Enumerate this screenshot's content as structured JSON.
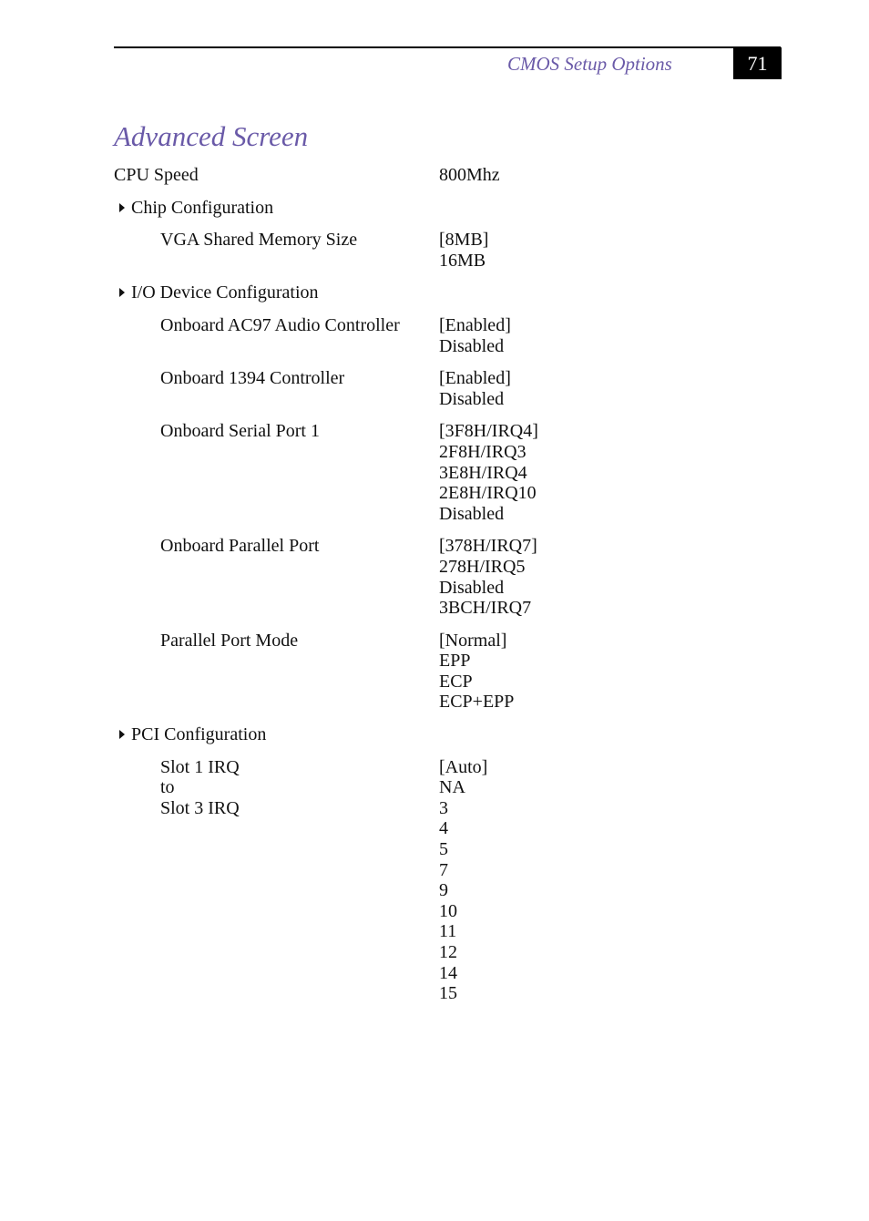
{
  "header": {
    "running_title": "CMOS Setup Options",
    "page_number": "71"
  },
  "title": "Advanced Screen",
  "cpu_speed": {
    "label": "CPU Speed",
    "value": "800Mhz"
  },
  "sections": [
    {
      "heading": "Chip Configuration",
      "items": [
        {
          "label": [
            "VGA Shared Memory Size"
          ],
          "options": [
            "[8MB]",
            "16MB"
          ]
        }
      ]
    },
    {
      "heading": "I/O Device Configuration",
      "items": [
        {
          "label": [
            "Onboard AC97 Audio Controller"
          ],
          "options": [
            "[Enabled]",
            "Disabled"
          ]
        },
        {
          "label": [
            "Onboard 1394 Controller"
          ],
          "options": [
            "[Enabled]",
            "Disabled"
          ]
        },
        {
          "label": [
            "Onboard Serial Port 1"
          ],
          "options": [
            "[3F8H/IRQ4]",
            "2F8H/IRQ3",
            "3E8H/IRQ4",
            "2E8H/IRQ10",
            "Disabled"
          ]
        },
        {
          "label": [
            "Onboard Parallel Port"
          ],
          "options": [
            "[378H/IRQ7]",
            "278H/IRQ5",
            "Disabled",
            "3BCH/IRQ7"
          ]
        },
        {
          "label": [
            "Parallel Port Mode"
          ],
          "options": [
            "[Normal]",
            "EPP",
            "ECP",
            "ECP+EPP"
          ]
        }
      ]
    },
    {
      "heading": "PCI Configuration",
      "items": [
        {
          "label": [
            "Slot 1 IRQ",
            "to",
            "Slot 3 IRQ"
          ],
          "options": [
            "[Auto]",
            "NA",
            "3",
            "4",
            "5",
            "7",
            "9",
            "10",
            "11",
            "12",
            "14",
            "15"
          ]
        }
      ]
    }
  ]
}
